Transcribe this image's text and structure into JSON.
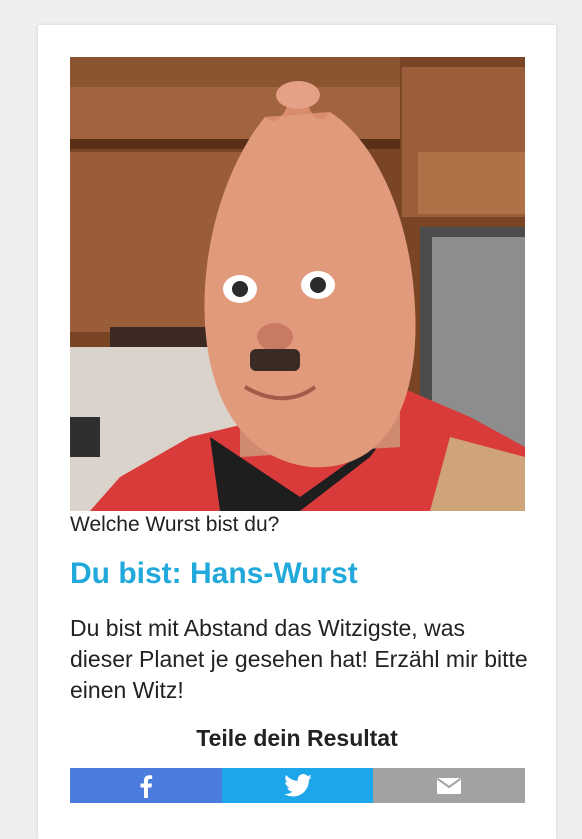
{
  "quiz": {
    "title": "Welche Wurst bist du?",
    "result": "Du bist: Hans-Wurst",
    "description": "Du bist mit Abstand das Witzigste, was dieser Planet je gesehen hat! Erzähl mir bitte einen Witz!",
    "share_heading": "Teile dein Resultat"
  },
  "photo": {
    "alt": "Hans-Wurst"
  },
  "share": {
    "buttons": [
      {
        "icon": "facebook-icon",
        "color": "#4a7bdd"
      },
      {
        "icon": "twitter-icon",
        "color": "#1da7ea"
      },
      {
        "icon": "mail-icon",
        "color": "#a2a2a2"
      }
    ]
  },
  "colors": {
    "accent": "#22a9db",
    "text": "#222222"
  }
}
